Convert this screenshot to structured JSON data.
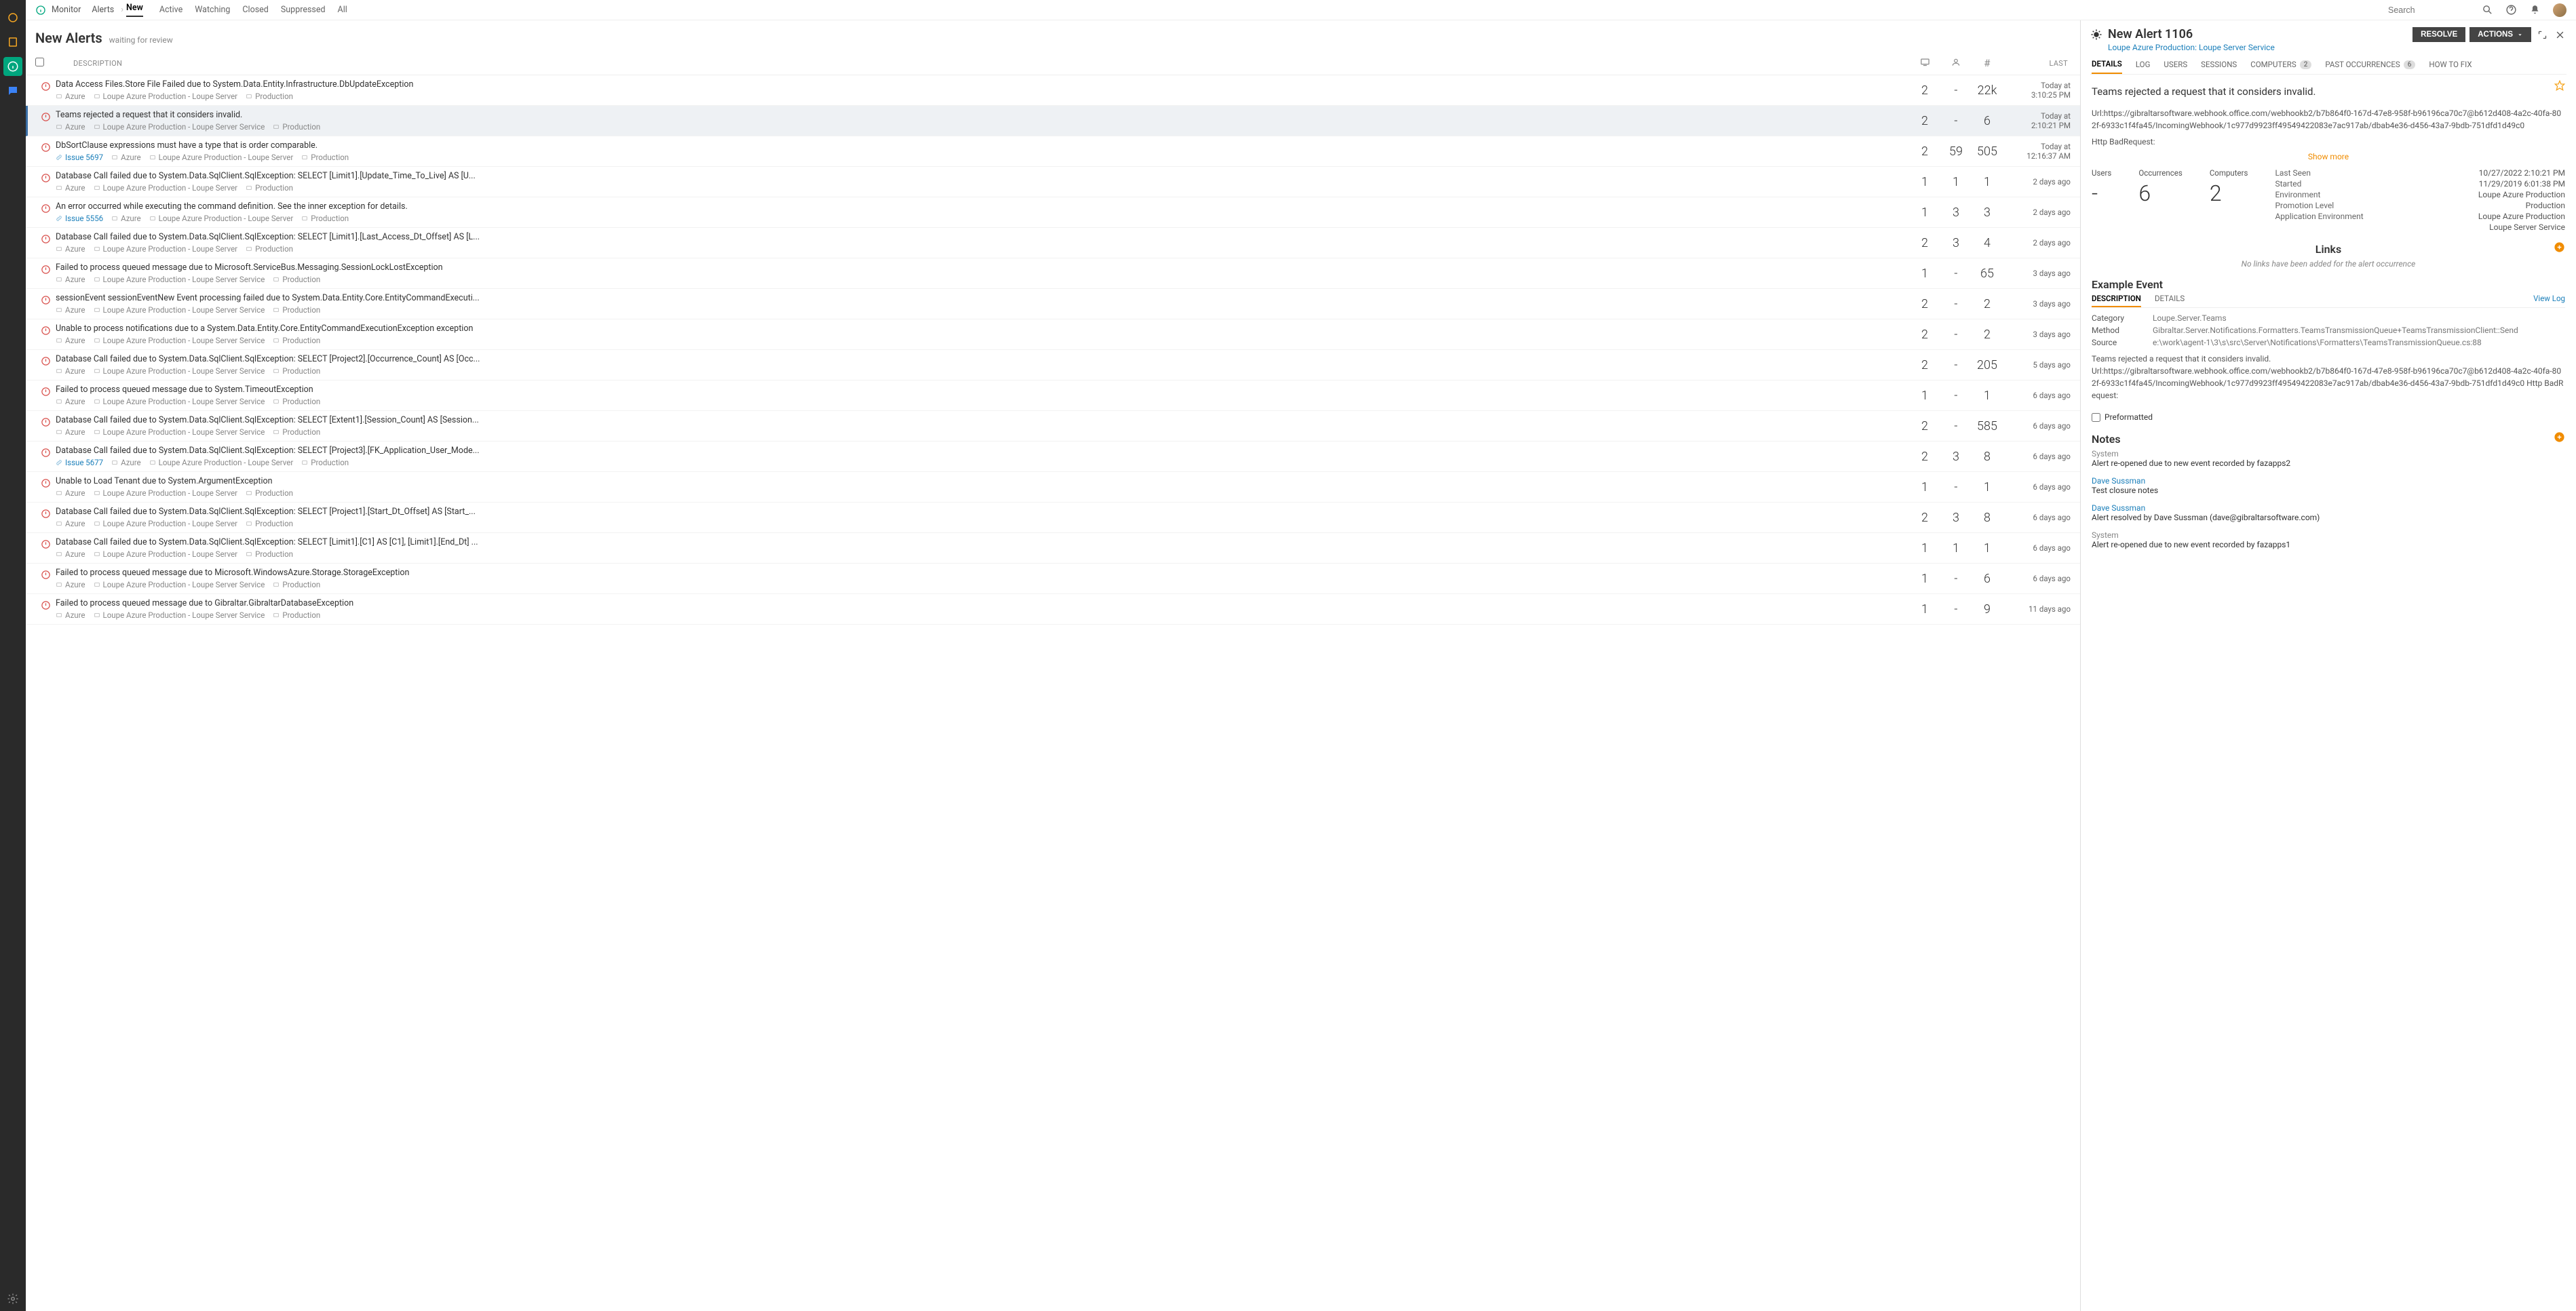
{
  "topbar": {
    "monitor": "Monitor",
    "alerts": "Alerts",
    "new": "New",
    "tabs": [
      "Active",
      "Watching",
      "Closed",
      "Suppressed",
      "All"
    ],
    "search_placeholder": "Search"
  },
  "list": {
    "title": "New Alerts",
    "subtitle": "waiting for review",
    "hdr_desc": "DESCRIPTION",
    "hdr_last": "LAST",
    "rows": [
      {
        "title": "Data Access Files.Store File Failed due to System.Data.Entity.Infrastructure.DbUpdateException",
        "issue": "",
        "tenant": "Azure",
        "app": "Loupe Azure Production - Loupe Server",
        "env": "Production",
        "c1": "2",
        "c2": "-",
        "c3": "22k",
        "last1": "Today at",
        "last2": "3:10:25 PM",
        "selected": false
      },
      {
        "title": "Teams rejected a request that it considers invalid.",
        "issue": "",
        "tenant": "Azure",
        "app": "Loupe Azure Production - Loupe Server Service",
        "env": "Production",
        "c1": "2",
        "c2": "-",
        "c3": "6",
        "last1": "Today at",
        "last2": "2:10:21 PM",
        "selected": true
      },
      {
        "title": "DbSortClause expressions must have a type that is order comparable.",
        "issue": "Issue 5697",
        "tenant": "Azure",
        "app": "Loupe Azure Production - Loupe Server",
        "env": "Production",
        "c1": "2",
        "c2": "59",
        "c3": "505",
        "last1": "Today at",
        "last2": "12:16:37 AM",
        "selected": false
      },
      {
        "title": "Database Call failed due to System.Data.SqlClient.SqlException: SELECT [Limit1].[Update_Time_To_Live] AS [U...",
        "issue": "",
        "tenant": "Azure",
        "app": "Loupe Azure Production - Loupe Server",
        "env": "Production",
        "c1": "1",
        "c2": "1",
        "c3": "1",
        "last1": "2 days ago",
        "last2": "",
        "selected": false
      },
      {
        "title": "An error occurred while executing the command definition. See the inner exception for details.",
        "issue": "Issue 5556",
        "tenant": "Azure",
        "app": "Loupe Azure Production - Loupe Server",
        "env": "Production",
        "c1": "1",
        "c2": "3",
        "c3": "3",
        "last1": "2 days ago",
        "last2": "",
        "selected": false
      },
      {
        "title": "Database Call failed due to System.Data.SqlClient.SqlException: SELECT [Limit1].[Last_Access_Dt_Offset] AS [L...",
        "issue": "",
        "tenant": "Azure",
        "app": "Loupe Azure Production - Loupe Server",
        "env": "Production",
        "c1": "2",
        "c2": "3",
        "c3": "4",
        "last1": "2 days ago",
        "last2": "",
        "selected": false
      },
      {
        "title": "Failed to process queued message due to Microsoft.ServiceBus.Messaging.SessionLockLostException",
        "issue": "",
        "tenant": "Azure",
        "app": "Loupe Azure Production - Loupe Server Service",
        "env": "Production",
        "c1": "1",
        "c2": "-",
        "c3": "65",
        "last1": "3 days ago",
        "last2": "",
        "selected": false
      },
      {
        "title": "sessionEvent sessionEventNew Event processing failed due to System.Data.Entity.Core.EntityCommandExecuti...",
        "issue": "",
        "tenant": "Azure",
        "app": "Loupe Azure Production - Loupe Server Service",
        "env": "Production",
        "c1": "2",
        "c2": "-",
        "c3": "2",
        "last1": "3 days ago",
        "last2": "",
        "selected": false
      },
      {
        "title": "Unable to process notifications due to a System.Data.Entity.Core.EntityCommandExecutionException exception",
        "issue": "",
        "tenant": "Azure",
        "app": "Loupe Azure Production - Loupe Server Service",
        "env": "Production",
        "c1": "2",
        "c2": "-",
        "c3": "2",
        "last1": "3 days ago",
        "last2": "",
        "selected": false
      },
      {
        "title": "Database Call failed due to System.Data.SqlClient.SqlException: SELECT [Project2].[Occurrence_Count] AS [Occ...",
        "issue": "",
        "tenant": "Azure",
        "app": "Loupe Azure Production - Loupe Server Service",
        "env": "Production",
        "c1": "2",
        "c2": "-",
        "c3": "205",
        "last1": "5 days ago",
        "last2": "",
        "selected": false
      },
      {
        "title": "Failed to process queued message due to System.TimeoutException",
        "issue": "",
        "tenant": "Azure",
        "app": "Loupe Azure Production - Loupe Server Service",
        "env": "Production",
        "c1": "1",
        "c2": "-",
        "c3": "1",
        "last1": "6 days ago",
        "last2": "",
        "selected": false
      },
      {
        "title": "Database Call failed due to System.Data.SqlClient.SqlException: SELECT [Extent1].[Session_Count] AS [Session...",
        "issue": "",
        "tenant": "Azure",
        "app": "Loupe Azure Production - Loupe Server Service",
        "env": "Production",
        "c1": "2",
        "c2": "-",
        "c3": "585",
        "last1": "6 days ago",
        "last2": "",
        "selected": false
      },
      {
        "title": "Database Call failed due to System.Data.SqlClient.SqlException: SELECT [Project3].[FK_Application_User_Mode...",
        "issue": "Issue 5677",
        "tenant": "Azure",
        "app": "Loupe Azure Production - Loupe Server",
        "env": "Production",
        "c1": "2",
        "c2": "3",
        "c3": "8",
        "last1": "6 days ago",
        "last2": "",
        "selected": false
      },
      {
        "title": "Unable to Load Tenant due to System.ArgumentException",
        "issue": "",
        "tenant": "Azure",
        "app": "Loupe Azure Production - Loupe Server",
        "env": "Production",
        "c1": "1",
        "c2": "-",
        "c3": "1",
        "last1": "6 days ago",
        "last2": "",
        "selected": false
      },
      {
        "title": "Database Call failed due to System.Data.SqlClient.SqlException: SELECT [Project1].[Start_Dt_Offset] AS [Start_...",
        "issue": "",
        "tenant": "Azure",
        "app": "Loupe Azure Production - Loupe Server",
        "env": "Production",
        "c1": "2",
        "c2": "3",
        "c3": "8",
        "last1": "6 days ago",
        "last2": "",
        "selected": false
      },
      {
        "title": "Database Call failed due to System.Data.SqlClient.SqlException: SELECT [Limit1].[C1] AS [C1], [Limit1].[End_Dt] ...",
        "issue": "",
        "tenant": "Azure",
        "app": "Loupe Azure Production - Loupe Server",
        "env": "Production",
        "c1": "1",
        "c2": "1",
        "c3": "1",
        "last1": "6 days ago",
        "last2": "",
        "selected": false
      },
      {
        "title": "Failed to process queued message due to Microsoft.WindowsAzure.Storage.StorageException",
        "issue": "",
        "tenant": "Azure",
        "app": "Loupe Azure Production - Loupe Server Service",
        "env": "Production",
        "c1": "1",
        "c2": "-",
        "c3": "6",
        "last1": "6 days ago",
        "last2": "",
        "selected": false
      },
      {
        "title": "Failed to process queued message due to Gibraltar.GibraltarDatabaseException",
        "issue": "",
        "tenant": "Azure",
        "app": "Loupe Azure Production - Loupe Server Service",
        "env": "Production",
        "c1": "1",
        "c2": "-",
        "c3": "9",
        "last1": "11 days ago",
        "last2": "",
        "selected": false
      }
    ]
  },
  "detail": {
    "title": "New Alert 1106",
    "subtitle": "Loupe Azure Production: Loupe Server Service",
    "btn_resolve": "RESOLVE",
    "btn_actions": "ACTIONS",
    "tabs": {
      "details": "DETAILS",
      "log": "LOG",
      "users": "USERS",
      "sessions": "SESSIONS",
      "computers": "COMPUTERS",
      "computers_badge": "2",
      "past": "PAST OCCURRENCES",
      "past_badge": "6",
      "howto": "HOW TO FIX"
    },
    "summary": "Teams rejected a request that it considers invalid.",
    "desc_lines": [
      "Url:https://gibraltarsoftware.webhook.office.com/webhookb2/b7b864f0-167d-47e8-958f-b96196ca70c7@b612d408-4a2c-40fa-802f-6933c1f4fa45/IncomingWebhook/1c977d9923ff49549422083e7ac917ab/dbab4e36-d456-43a7-9bdb-751dfd1d49c0",
      "Http BadRequest:"
    ],
    "show_more": "Show more",
    "stats": {
      "users_lbl": "Users",
      "users_val": "-",
      "occ_lbl": "Occurrences",
      "occ_val": "6",
      "comp_lbl": "Computers",
      "comp_val": "2"
    },
    "kv": {
      "last_seen_k": "Last Seen",
      "last_seen_v": "10/27/2022 2:10:21 PM",
      "started_k": "Started",
      "started_v": "11/29/2019 6:01:38 PM",
      "env_k": "Environment",
      "env_v": "Loupe Azure Production",
      "promo_k": "Promotion Level",
      "promo_v": "Production",
      "appenv_k": "Application Environment",
      "appenv_v": "Loupe Azure Production",
      "appenv_v2": "Loupe Server Service"
    },
    "links_title": "Links",
    "links_empty": "No links have been added for the alert occurrence",
    "example_title": "Example Event",
    "subtabs": {
      "desc": "DESCRIPTION",
      "details": "DETAILS",
      "viewlog": "View Log"
    },
    "event_kv": {
      "cat_k": "Category",
      "cat_v": "Loupe.Server.Teams",
      "method_k": "Method",
      "method_v": "Gibraltar.Server.Notifications.Formatters.TeamsTransmissionQueue+TeamsTransmissionClient::Send",
      "src_k": "Source",
      "src_v": "e:\\work\\agent-1\\3\\s\\src\\Server\\Notifications\\Formatters\\TeamsTransmissionQueue.cs:88"
    },
    "example_desc": "Teams rejected a request that it considers invalid.\nUrl:https://gibraltarsoftware.webhook.office.com/webhookb2/b7b864f0-167d-47e8-958f-b96196ca70c7@b612d408-4a2c-40fa-802f-6933c1f4fa45/IncomingWebhook/1c977d9923ff49549422083e7ac917ab/dbab4e36-d456-43a7-9bdb-751dfd1d49c0 Http BadRequest:",
    "preformatted": "Preformatted",
    "notes_title": "Notes",
    "notes": [
      {
        "author": "System",
        "body": "Alert re-opened due to new event recorded by fazapps2",
        "link": false
      },
      {
        "author": "Dave Sussman",
        "body": "Test closure notes",
        "link": true
      },
      {
        "author": "Dave Sussman",
        "body": "Alert resolved by Dave Sussman (dave@gibraltarsoftware.com)",
        "link": true
      },
      {
        "author": "System",
        "body": "Alert re-opened due to new event recorded by fazapps1",
        "link": false
      }
    ]
  }
}
